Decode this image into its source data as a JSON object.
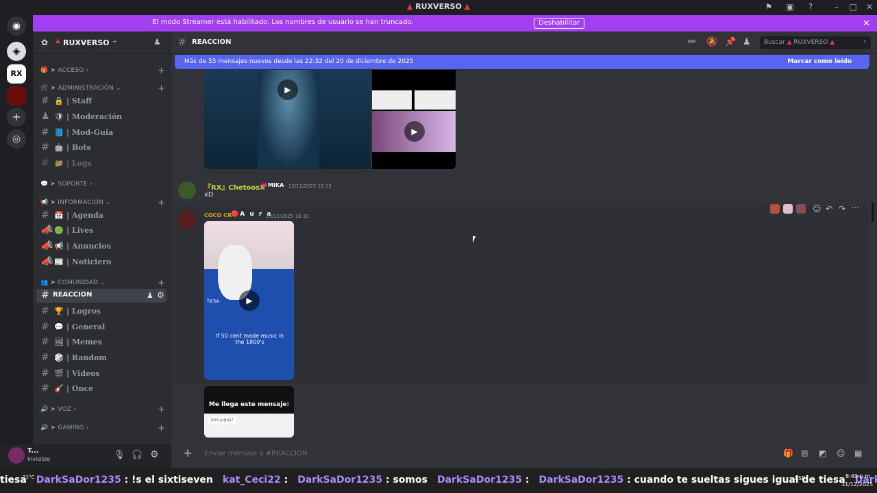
{
  "window": {
    "title": "RUXVERSO"
  },
  "streamer_bar": {
    "message": "El modo Streamer está habilitado. Los nombres de usuario se han truncado.",
    "button_label": "Deshabilitar"
  },
  "server": {
    "name": "RUXVERSO"
  },
  "sidebar": {
    "categories": {
      "acceso": "ACCESO",
      "administracion": "ADMINISTRACIÓN",
      "soporte": "SOPORTE",
      "informacion": "INFORMACIÓN",
      "comunidad": "COMUNIDAD",
      "voz": "VOZ",
      "gaming": "GAMING"
    },
    "admin_channels": [
      "| Staff",
      "| Moderación",
      "| Mod-Guia",
      "| Bots",
      "| Logs"
    ],
    "info_channels": [
      "| Agenda",
      "| Lives",
      "| Anuncios",
      "| Noticiero"
    ],
    "active_channel": "REACCION",
    "community_channels": [
      "| Logros",
      "| General",
      "| Memes",
      "| Random",
      "| Videos",
      "| Once"
    ]
  },
  "user_panel": {
    "name": "T...",
    "status": "Invisible"
  },
  "channel": {
    "name": "REACCION",
    "search_placeholder": "Buscar",
    "search_server": "RUXVERSO"
  },
  "new_messages_bar": {
    "text": "Más de 53 mensajes nuevos desde las 22:32 del 20 de diciembre de 2025",
    "action": "Marcar como leído"
  },
  "messages": [
    {
      "author": "『RX』ChetoosX",
      "tag": "MIKA",
      "timestamp": "23/12/2025 15:15",
      "text": "xD"
    },
    {
      "author": "COCO CR",
      "tag": "A u r a",
      "timestamp": "23/12/2025 16:32",
      "video_caption": "If 50 cent made music in the 1800's",
      "image_title": "Me llega este mensaje:",
      "image_bubble": "loro jugas?",
      "tiktok_label": "TikTok"
    }
  ],
  "composer": {
    "placeholder": "Enviar mensaje a #REACCION"
  },
  "taskbar": {
    "ticker": [
      {
        "u": "",
        "m": "tiesa"
      },
      {
        "u": "DarkSaDor1235",
        "m": ": !s el sixtiseven"
      },
      {
        "u": "kat_Ceci22",
        "m": ":"
      },
      {
        "u": "DarkSaDor1235",
        "m": ": somos"
      },
      {
        "u": "DarkSaDor1235",
        "m": ":"
      },
      {
        "u": "DarkSaDor1235",
        "m": ": cuando te sueltas sigues igual de tiesa"
      },
      {
        "u": "DarkSaDor1235",
        "m": ":"
      }
    ],
    "weather": "21°C",
    "lang": "ESP",
    "time": "8:49 p.m.",
    "date": "31/12/2025"
  },
  "colors": {
    "accent": "#5865f2",
    "streamer_bar": "#a23ff0",
    "username_green": "#c9d33b",
    "username_orange": "#e0a020"
  }
}
